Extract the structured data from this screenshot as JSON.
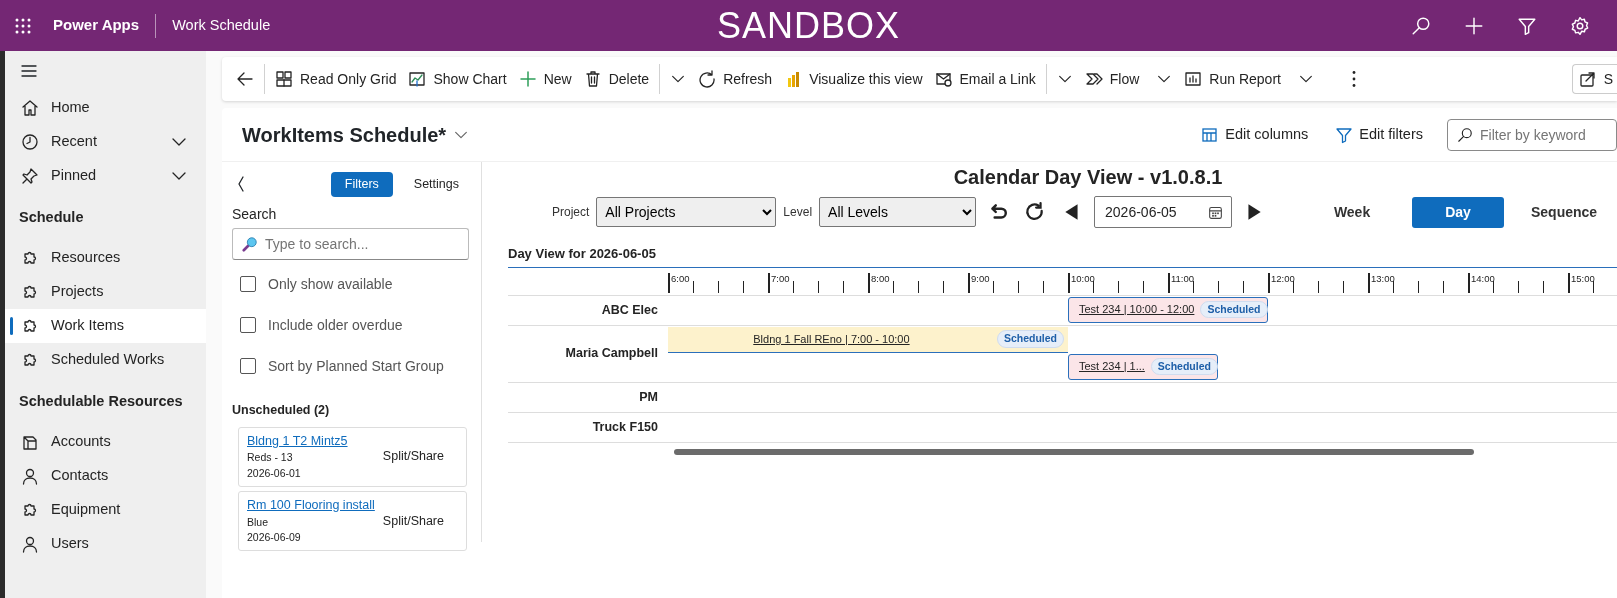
{
  "topbar": {
    "app": "Power Apps",
    "page": "Work Schedule",
    "environment": "SANDBOX",
    "actions": [
      {
        "kind": "search"
      },
      {
        "kind": "add"
      },
      {
        "kind": "filter"
      },
      {
        "kind": "settings"
      }
    ]
  },
  "sidebar": {
    "top": [
      {
        "label": "Home",
        "selected": false
      },
      {
        "label": "Recent",
        "selected": false,
        "expanded": false
      },
      {
        "label": "Pinned",
        "selected": false,
        "expanded": false
      }
    ],
    "sections": [
      {
        "title": "Schedule",
        "items": [
          {
            "label": "Resources",
            "selected": false
          },
          {
            "label": "Projects",
            "selected": false
          },
          {
            "label": "Work Items",
            "selected": true
          },
          {
            "label": "Scheduled Works",
            "selected": false
          }
        ]
      },
      {
        "title": "Schedulable Resources",
        "items": [
          {
            "label": "Accounts",
            "selected": false
          },
          {
            "label": "Contacts",
            "selected": false
          },
          {
            "label": "Equipment",
            "selected": false
          },
          {
            "label": "Users",
            "selected": false
          }
        ]
      }
    ]
  },
  "toolbar": [
    {
      "kind": "back"
    },
    {
      "kind": "grid",
      "label": "Read Only Grid"
    },
    {
      "kind": "chart",
      "label": "Show Chart"
    },
    {
      "kind": "new",
      "label": "New"
    },
    {
      "kind": "delete",
      "label": "Delete"
    },
    {
      "kind": "more"
    },
    {
      "kind": "refresh",
      "label": "Refresh"
    },
    {
      "kind": "visualize",
      "label": "Visualize this view"
    },
    {
      "kind": "email",
      "label": "Email a Link"
    },
    {
      "kind": "more"
    },
    {
      "kind": "flow",
      "label": "Flow",
      "dropdown": true
    },
    {
      "kind": "report",
      "label": "Run Report",
      "dropdown": true
    },
    {
      "kind": "overflow"
    },
    {
      "kind": "share",
      "label": "S"
    }
  ],
  "view": {
    "title": "WorkItems Schedule*",
    "actions": [
      {
        "kind": "columns",
        "label": "Edit columns"
      },
      {
        "kind": "filters",
        "label": "Edit filters"
      }
    ],
    "keyword": {
      "placeholder": "Filter by keyword"
    }
  },
  "filter_pane": {
    "tabs": [
      {
        "label": "Filters",
        "selected": true
      },
      {
        "label": "Settings",
        "selected": false
      }
    ],
    "search_label": "Search",
    "search": {
      "placeholder": "Type to search..."
    },
    "options": [
      {
        "label": "Only show available",
        "checked": false
      },
      {
        "label": "Include older overdue",
        "checked": false
      },
      {
        "label": "Sort by Planned Start Group",
        "checked": false
      }
    ],
    "unscheduled_title": "Unscheduled (2)",
    "unscheduled": [
      {
        "title": "Bldng 1 T2 Mintz5",
        "detail": "Reds - 13",
        "date": "2026-06-01",
        "action": "Split/Share"
      },
      {
        "title": "Rm 100 Flooring install",
        "detail": "Blue",
        "date": "2026-06-09",
        "action": "Split/Share"
      }
    ]
  },
  "calendar": {
    "title": "Calendar Day View - v1.0.8.1",
    "project_label": "Project",
    "project": "All Projects",
    "level_label": "Level",
    "level": "All Levels",
    "date": "2026-06-05",
    "views": [
      {
        "label": "Week",
        "selected": false
      },
      {
        "label": "Day",
        "selected": true
      },
      {
        "label": "Sequence",
        "selected": false
      }
    ],
    "heading": "Day View for 2026-06-05",
    "hours": [
      "6:00",
      "7:00",
      "8:00",
      "9:00",
      "10:00",
      "11:00",
      "12:00",
      "13:00",
      "14:00",
      "15:00"
    ],
    "rows": [
      {
        "name": "ABC Elec",
        "events": [
          {
            "title": "Test 234 | 10:00 - 12:00",
            "status": "Scheduled",
            "color": "#fbe5e8",
            "flagged": true
          }
        ]
      },
      {
        "name": "Maria Campbell",
        "events": [
          {
            "title": "Bldng 1 Fall REno | 7:00 - 10:00",
            "status": "Scheduled",
            "color": "#fdf2cc",
            "flagged": false
          },
          {
            "title": "Test 234 | 1...",
            "status": "Scheduled",
            "color": "#fbe5e8",
            "flagged": true
          }
        ]
      },
      {
        "name": "PM",
        "events": []
      },
      {
        "name": "Truck F150",
        "events": []
      }
    ]
  }
}
